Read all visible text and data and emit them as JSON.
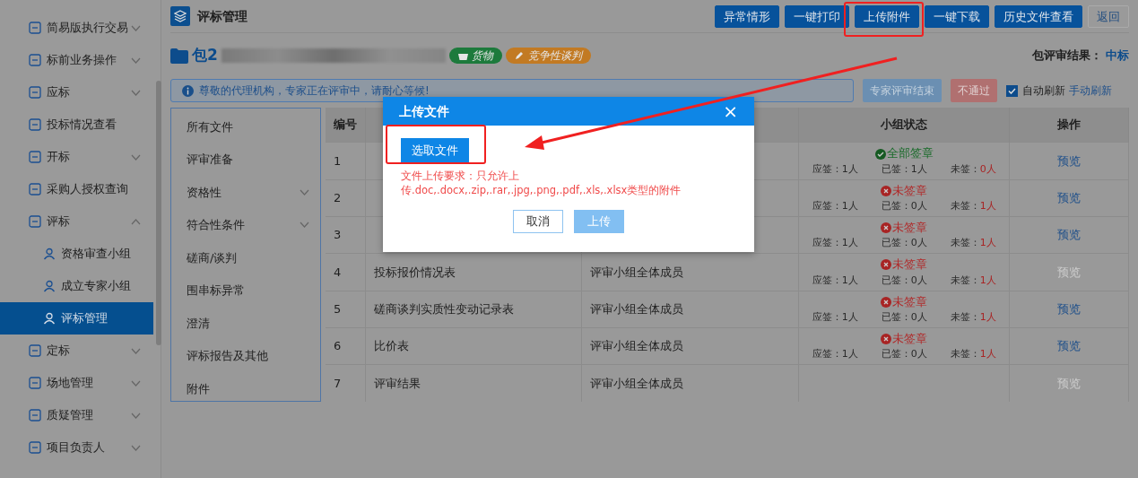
{
  "sidebar": {
    "items": [
      {
        "label": "简易版执行交易",
        "expanded": false,
        "selected": false
      },
      {
        "label": "标前业务操作",
        "expanded": false,
        "selected": false
      },
      {
        "label": "应标",
        "expanded": false,
        "selected": false
      },
      {
        "label": "投标情况查看",
        "selected": false
      },
      {
        "label": "开标",
        "expanded": false,
        "selected": false
      },
      {
        "label": "采购人授权查询",
        "selected": false
      },
      {
        "label": "评标",
        "selected": false,
        "expanded": true,
        "children": [
          {
            "label": "资格审查小组",
            "selected": false
          },
          {
            "label": "成立专家小组",
            "selected": false
          },
          {
            "label": "评标管理",
            "selected": true
          }
        ]
      },
      {
        "label": "定标",
        "expanded": false,
        "selected": false
      },
      {
        "label": "场地管理",
        "expanded": false,
        "selected": false
      },
      {
        "label": "质疑管理",
        "expanded": false,
        "selected": false
      },
      {
        "label": "项目负责人",
        "expanded": false,
        "selected": false
      }
    ]
  },
  "header": {
    "title": "评标管理",
    "buttons": [
      {
        "label": "异常情形",
        "kind": "primary"
      },
      {
        "label": "一键打印",
        "kind": "primary"
      },
      {
        "label": "上传附件",
        "kind": "primary"
      },
      {
        "label": "一键下载",
        "kind": "primary"
      },
      {
        "label": "历史文件查看",
        "kind": "primary"
      },
      {
        "label": "返回",
        "kind": "outline"
      }
    ]
  },
  "package": {
    "title": "包2",
    "tags": [
      {
        "label": "货物",
        "color": "#1d7a3c"
      },
      {
        "label": "竞争性谈判",
        "color": "#c27a23"
      }
    ],
    "result_label": "包评审结果：",
    "result": "中标"
  },
  "notice": {
    "text": "尊敬的代理机构，专家正在评审中，请耐心等候!",
    "buttons": [
      {
        "label": "专家评审结束",
        "kind": "info"
      },
      {
        "label": "不通过",
        "kind": "danger"
      }
    ],
    "auto_refresh": {
      "label": "自动刷新",
      "checked": true
    },
    "manual_refresh": "手动刷新"
  },
  "file_menu": [
    {
      "label": "所有文件"
    },
    {
      "label": "评审准备"
    },
    {
      "label": "资格性",
      "expanded": false
    },
    {
      "label": "符合性条件",
      "expanded": false
    },
    {
      "label": "磋商/谈判"
    },
    {
      "label": "围串标异常"
    },
    {
      "label": "澄清"
    },
    {
      "label": "评标报告及其他"
    },
    {
      "label": "附件"
    }
  ],
  "table": {
    "columns": [
      {
        "label": "编号"
      },
      {},
      {},
      {
        "label": "小组状态"
      },
      {
        "label": "操作"
      }
    ],
    "rows": [
      {
        "number": "1",
        "status": {
          "kind": "signed",
          "label": "全部签章",
          "due": "应签：1人",
          "signed": "已签：1人",
          "unsigned_label": "未签：",
          "unsigned": "0人"
        },
        "action": "预览",
        "disabled": false
      },
      {
        "number": "2",
        "status": {
          "kind": "unsigned",
          "label": "未签章",
          "due": "应签：1人",
          "signed": "已签：0人",
          "unsigned_label": "未签：",
          "unsigned": "1人"
        },
        "action": "预览",
        "disabled": false
      },
      {
        "number": "3",
        "status": {
          "kind": "unsigned",
          "label": "未签章",
          "due": "应签：1人",
          "signed": "已签：0人",
          "unsigned_label": "未签：",
          "unsigned": "1人"
        },
        "action": "预览",
        "disabled": false
      },
      {
        "number": "4",
        "file": "投标报价情况表",
        "signer": "评审小组全体成员",
        "status": {
          "kind": "unsigned",
          "label": "未签章",
          "due": "应签：1人",
          "signed": "已签：0人",
          "unsigned_label": "未签：",
          "unsigned": "1人"
        },
        "action": "预览",
        "disabled": true
      },
      {
        "number": "5",
        "file": "磋商谈判实质性变动记录表",
        "signer": "评审小组全体成员",
        "status": {
          "kind": "unsigned",
          "label": "未签章",
          "due": "应签：1人",
          "signed": "已签：0人",
          "unsigned_label": "未签：",
          "unsigned": "1人"
        },
        "action": "预览",
        "disabled": false
      },
      {
        "number": "6",
        "file": "比价表",
        "signer": "评审小组全体成员",
        "status": {
          "kind": "unsigned",
          "label": "未签章",
          "due": "应签：1人",
          "signed": "已签：0人",
          "unsigned_label": "未签：",
          "unsigned": "1人"
        },
        "action": "预览",
        "disabled": false
      },
      {
        "number": "7",
        "file": "评审结果",
        "signer": "评审小组全体成员",
        "action": "预览",
        "disabled": true
      }
    ]
  },
  "modal": {
    "title": "上传文件",
    "close": "×",
    "pick_button": "选取文件",
    "hint": "文件上传要求：只允许上传.doc,.docx,.zip,.rar,.jpg,.png,.pdf,.xls,.xlsx类型的附件",
    "buttons": [
      {
        "label": "取消",
        "kind": "outline"
      },
      {
        "label": "上传",
        "kind": "disabled"
      }
    ]
  }
}
